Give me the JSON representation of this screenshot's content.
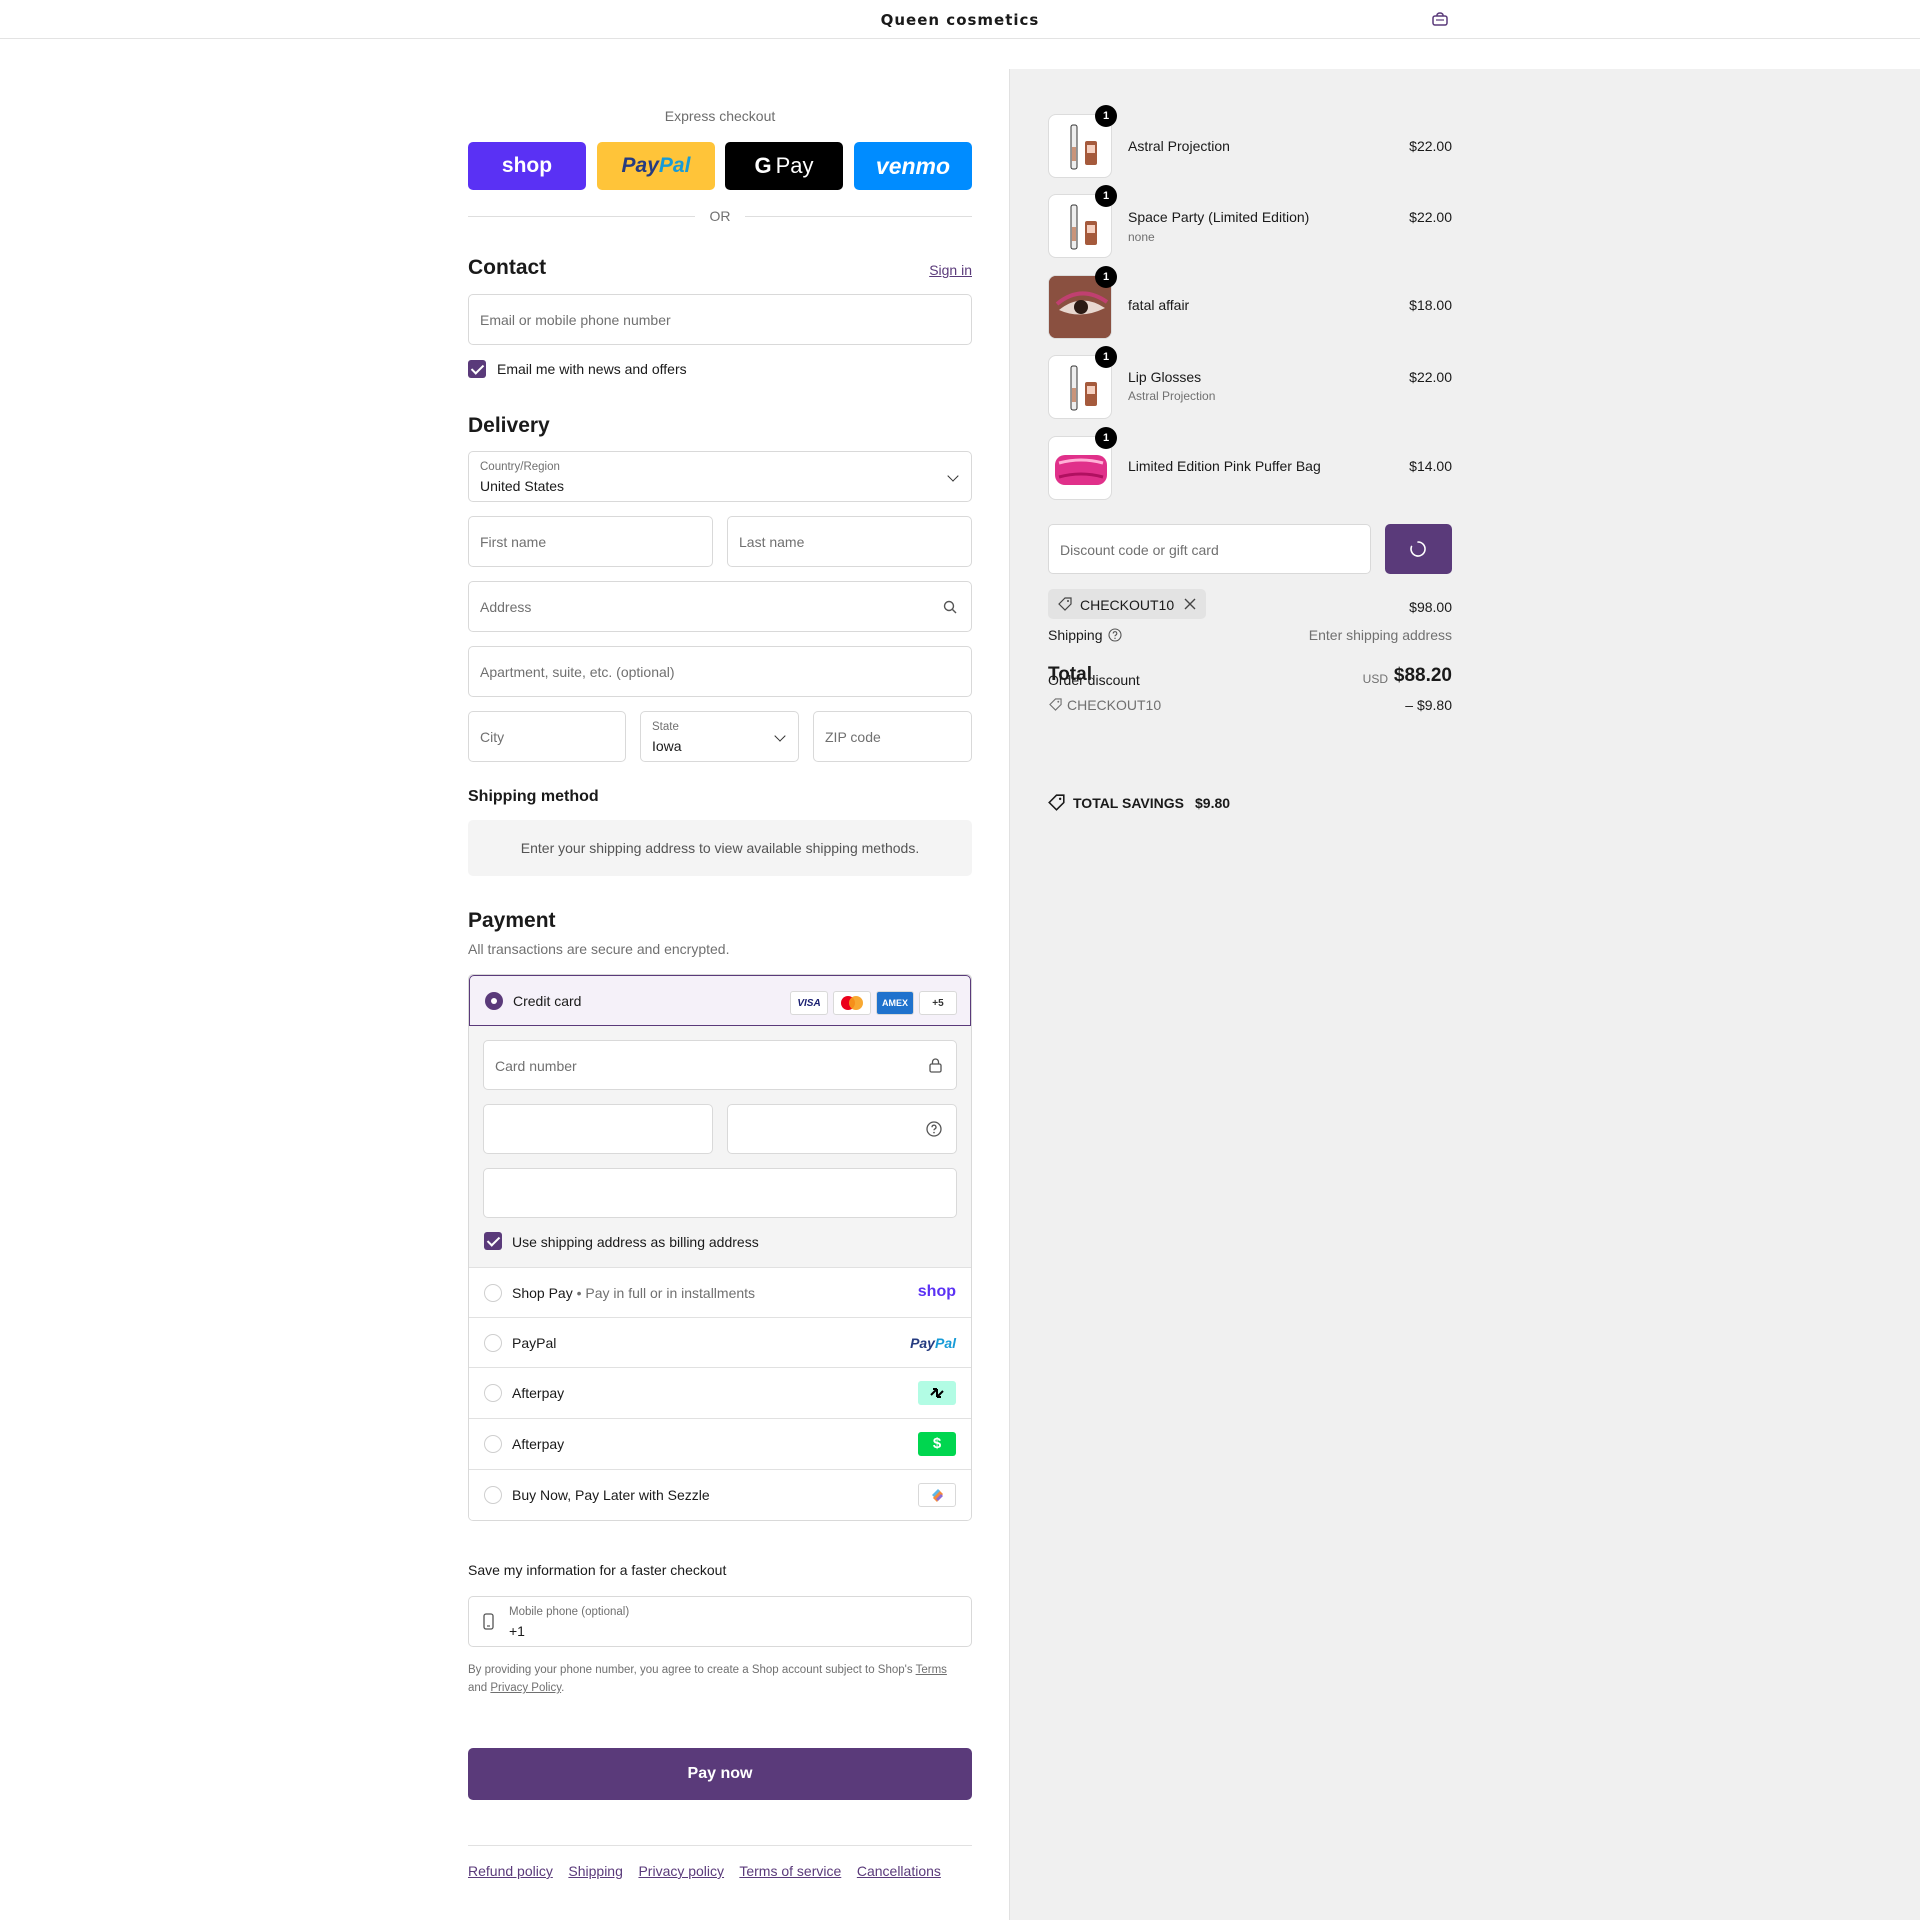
{
  "header": {
    "brand": "Queen cosmetics",
    "cart_icon": "bag-icon"
  },
  "express": {
    "title": "Express checkout",
    "buttons": {
      "shop": "shop",
      "paypal_a": "Pay",
      "paypal_b": "Pal",
      "gpay": "Pay",
      "venmo": "venmo"
    },
    "or": "OR"
  },
  "contact": {
    "heading": "Contact",
    "sign_in": "Sign in",
    "email_placeholder": "Email or mobile phone number",
    "newsletter_label": "Email me with news and offers"
  },
  "delivery": {
    "heading": "Delivery",
    "country_label": "Country/Region",
    "country_value": "United States",
    "first_name": "First name",
    "last_name": "Last name",
    "address": "Address",
    "apartment": "Apartment, suite, etc. (optional)",
    "city": "City",
    "state_label": "State",
    "state_value": "Iowa",
    "zip": "ZIP code"
  },
  "shipping_method": {
    "heading": "Shipping method",
    "notice": "Enter your shipping address to view available shipping methods."
  },
  "payment": {
    "heading": "Payment",
    "subtitle": "All transactions are secure and encrypted.",
    "credit_card": "Credit card",
    "card_logos": {
      "visa": "VISA",
      "amex": "AMEX",
      "more": "+5"
    },
    "card_number": "Card number",
    "billing_same": "Use shipping address as billing address",
    "options": [
      {
        "name": "Shop Pay",
        "sub": "Pay in full or in installments",
        "logo": "shop"
      },
      {
        "name": "PayPal",
        "logo_a": "Pay",
        "logo_b": "Pal"
      },
      {
        "name": "Afterpay"
      },
      {
        "name": "Afterpay"
      },
      {
        "name": "Buy Now, Pay Later with Sezzle"
      }
    ]
  },
  "save_info": {
    "heading": "Save my information for a faster checkout",
    "phone_label": "Mobile phone (optional)",
    "phone_value": "+1",
    "legal_1": "By providing your phone number, you agree to create a Shop account subject to Shop's ",
    "terms": "Terms",
    "legal_2": "and ",
    "privacy": "Privacy Policy",
    "legal_3": "."
  },
  "pay_now": "Pay now",
  "footer_links": [
    "Refund policy",
    "Shipping",
    "Privacy policy",
    "Terms of service",
    "Cancellations"
  ],
  "order": {
    "items": [
      {
        "name": "Astral Projection",
        "sub": "",
        "price": "$22.00",
        "qty": "1"
      },
      {
        "name": "Space Party (Limited Edition)",
        "sub": "none",
        "price": "$22.00",
        "qty": "1"
      },
      {
        "name": "fatal affair",
        "sub": "",
        "price": "$18.00",
        "qty": "1"
      },
      {
        "name": "Lip Glosses",
        "sub": "Astral Projection",
        "price": "$22.00",
        "qty": "1"
      },
      {
        "name": "Limited Edition Pink Puffer Bag",
        "sub": "",
        "price": "$14.00",
        "qty": "1"
      }
    ],
    "discount_placeholder": "Discount code or gift card",
    "applied_code": "CHECKOUT10",
    "subtotal": "$98.00",
    "shipping_label": "Shipping",
    "shipping_value": "Enter shipping address",
    "total_label": "Total",
    "order_discount_label": "Order discount",
    "currency": "USD",
    "total": "$88.20",
    "discount_code": "CHECKOUT10",
    "discount_amount": "– $9.80",
    "savings_label": "TOTAL SAVINGS",
    "savings_value": "$9.80"
  },
  "colors": {
    "accent": "#5a3a7a",
    "shop": "#5a31f4",
    "paypal": "#ffc439",
    "venmo": "#008cff"
  }
}
